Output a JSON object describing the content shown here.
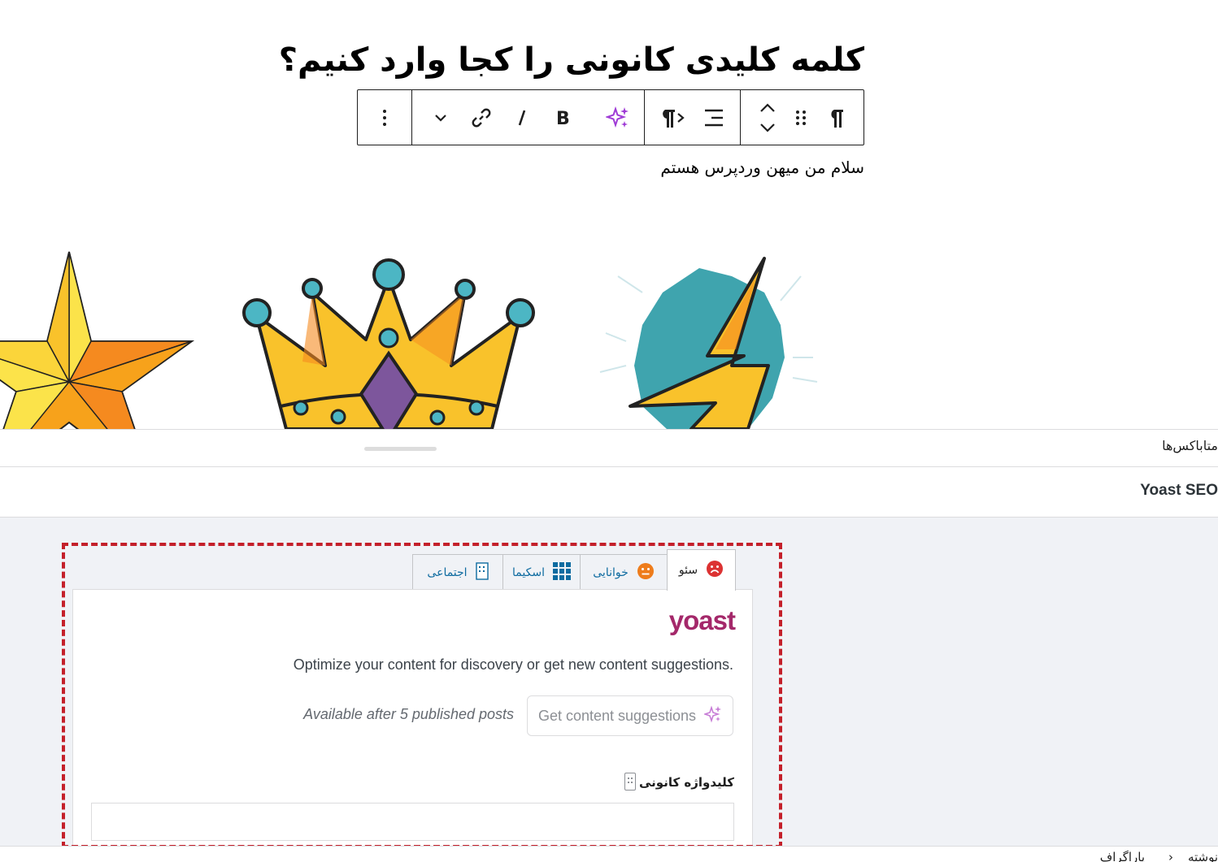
{
  "post": {
    "title": "کلمه کلیدی کانونی را کجا وارد کنیم؟",
    "paragraph": "سلام من میهن وردپرس هستم"
  },
  "toolbar": {
    "buttons": [
      "paragraph-icon",
      "drag-icon",
      "move-up-down-icon",
      "align-icon",
      "text-direction-icon",
      "ai-sparkle-icon",
      "bold-icon",
      "italic-icon",
      "link-icon",
      "more-chevron-icon",
      "options-icon"
    ]
  },
  "metaboxes": {
    "label": "متاباکس‌ها"
  },
  "yoast": {
    "section_label": "Yoast SEO",
    "tabs": [
      {
        "label": "سئو",
        "status": "bad"
      },
      {
        "label": "خوانایی",
        "status": "ok"
      },
      {
        "label": "اسکیما",
        "status": "none"
      },
      {
        "label": "اجتماعی",
        "status": "none"
      }
    ],
    "logo": "yoast",
    "optimize_text": "Optimize your content for discovery or get new content suggestions.",
    "suggest_button": "Get content suggestions",
    "available_text": "Available after 5 published posts",
    "focus_keyphrase_label": "کلیدواژه کانونی",
    "focus_keyphrase_value": ""
  },
  "footer": {
    "crumb_1": "نوشته",
    "crumb_2": "پاراگراف"
  },
  "colors": {
    "highlight": "#c4202a",
    "yoast_brand": "#a4286a",
    "bad": "#dc3232",
    "ok": "#ee7c1b",
    "link": "#0e6ba0",
    "ai": "#9f3bd6"
  }
}
